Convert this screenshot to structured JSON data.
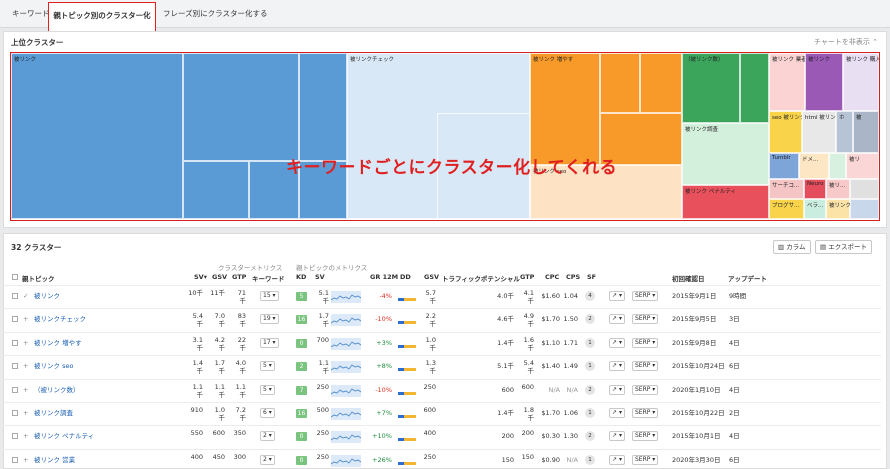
{
  "tabs": {
    "keyword": "キーワード",
    "parent": "親トピック別のクラスター化",
    "phrase": "フレーズ別にクラスター化する"
  },
  "top": {
    "title": "上位クラスター",
    "hide": "チャートを非表示",
    "annotation": "キーワードごとにクラスター化してくれる"
  },
  "tm_labels": {
    "a": "被リンク",
    "b": "被リンクチェック",
    "c": "被リンク 増やす",
    "d": "被リンク seo",
    "e": "（被リンク数）",
    "f": "被リンク調査",
    "g": "被リンク ペナルティ",
    "h": "被リンク 業者",
    "i": "被リンク",
    "j": "被リンク 購入",
    "k": "seo 被リンク",
    "l": "html 被リンク",
    "m": "被リンク",
    "n": "被リンク 確認",
    "o": "ブログ 被リンク",
    "p": "被リンク",
    "q": "Tumblr",
    "r": "ドメ...",
    "s": "被リ",
    "t": "サーチコ...",
    "u": "被リ...",
    "v": "ベラ...",
    "w": "ブログサ...",
    "x": "ホ",
    "y": "被",
    "z": "Neuro"
  },
  "clusters": {
    "title": "32 クラスター",
    "columns": "カラム",
    "export": "エクスポート"
  },
  "groups": {
    "cluster": "クラスターメトリクス",
    "parent": "親トピックのメトリクス"
  },
  "headers": {
    "topic": "親トピック",
    "sv": "SV",
    "gsv": "GSV",
    "gtp": "GTP",
    "kw": "キーワード",
    "kd": "KD",
    "sv2": "SV",
    "gr": "GR 12M",
    "dd": "DD",
    "gsv2": "GSV",
    "tp": "トラフィックポテンシャル",
    "gtp2": "GTP",
    "cpc": "CPC",
    "cps": "CPS",
    "sf": "SF",
    "first": "初回確認日",
    "update": "アップデート"
  },
  "rows": [
    {
      "icon": "✓",
      "topic": "被リンク",
      "sv": "10千",
      "gsv": "11千",
      "gtp": "71\n千",
      "kw": "15",
      "kd": "5",
      "sv2": "5.1\n千",
      "gr": "-4%",
      "gsv2": "5.7\n千",
      "tp": "4.0千",
      "gtp2": "4.1\n千",
      "cpc": "$1.60",
      "cps": "1.04",
      "sf": "4",
      "serp": "SERP",
      "first": "2015年9月1日",
      "update": "9時間"
    },
    {
      "icon": "+",
      "topic": "被リンクチェック",
      "sv": "5.4\n千",
      "gsv": "7.0\n千",
      "gtp": "83\n千",
      "kw": "19",
      "kd": "16",
      "sv2": "1.7\n千",
      "gr": "-10%",
      "gsv2": "2.2\n千",
      "tp": "4.6千",
      "gtp2": "4.9\n千",
      "cpc": "$1.70",
      "cps": "1.50",
      "sf": "2",
      "serp": "SERP",
      "first": "2015年9月5日",
      "update": "3日"
    },
    {
      "icon": "+",
      "topic": "被リンク 増やす",
      "sv": "3.1\n千",
      "gsv": "4.2\n千",
      "gtp": "22\n千",
      "kw": "17",
      "kd": "0",
      "sv2": "700",
      "gr": "+3%",
      "gsv2": "1.0\n千",
      "tp": "1.4千",
      "gtp2": "1.6\n千",
      "cpc": "$1.10",
      "cps": "1.71",
      "sf": "1",
      "serp": "SERP",
      "first": "2015年9月8日",
      "update": "4日"
    },
    {
      "icon": "+",
      "topic": "被リンク seo",
      "sv": "1.4\n千",
      "gsv": "1.7\n千",
      "gtp": "4.0\n千",
      "kw": "5",
      "kd": "2",
      "sv2": "1.1\n千",
      "gr": "+8%",
      "gsv2": "1.3\n千",
      "tp": "5.1千",
      "gtp2": "5.4\n千",
      "cpc": "$1.40",
      "cps": "1.49",
      "sf": "1",
      "serp": "SERP",
      "first": "2015年10月24日",
      "update": "6日"
    },
    {
      "icon": "+",
      "topic": "（被リンク数）",
      "sv": "1.1\n千",
      "gsv": "1.1\n千",
      "gtp": "1.1\n千",
      "kw": "5",
      "kd": "7",
      "sv2": "250",
      "gr": "-10%",
      "gsv2": "250",
      "tp": "600",
      "gtp2": "600",
      "cpc": "N/A",
      "cps": "N/A",
      "sf": "2",
      "serp": "SERP",
      "first": "2020年1月10日",
      "update": "4日"
    },
    {
      "icon": "+",
      "topic": "被リンク調査",
      "sv": "910",
      "gsv": "1.0\n千",
      "gtp": "7.2\n千",
      "kw": "6",
      "kd": "16",
      "sv2": "500",
      "gr": "+7%",
      "gsv2": "600",
      "tp": "1.4千",
      "gtp2": "1.8\n千",
      "cpc": "$1.70",
      "cps": "1.06",
      "sf": "1",
      "serp": "SERP",
      "first": "2015年10月22日",
      "update": "2日"
    },
    {
      "icon": "+",
      "topic": "被リンク ペナルティ",
      "sv": "550",
      "gsv": "600",
      "gtp": "350",
      "kw": "2",
      "kd": "0",
      "sv2": "250",
      "gr": "+10%",
      "gsv2": "400",
      "tp": "200",
      "gtp2": "200",
      "cpc": "$0.30",
      "cps": "1.30",
      "sf": "2",
      "serp": "SERP",
      "first": "2015年10月1日",
      "update": "4日"
    },
    {
      "icon": "+",
      "topic": "被リンク 営業",
      "sv": "400",
      "gsv": "450",
      "gtp": "300",
      "kw": "2",
      "kd": "0",
      "sv2": "250",
      "gr": "+26%",
      "gsv2": "250",
      "tp": "150",
      "gtp2": "150",
      "cpc": "$0.90",
      "cps": "N/A",
      "sf": "1",
      "serp": "SERP",
      "first": "2020年3月30日",
      "update": "6日"
    }
  ]
}
